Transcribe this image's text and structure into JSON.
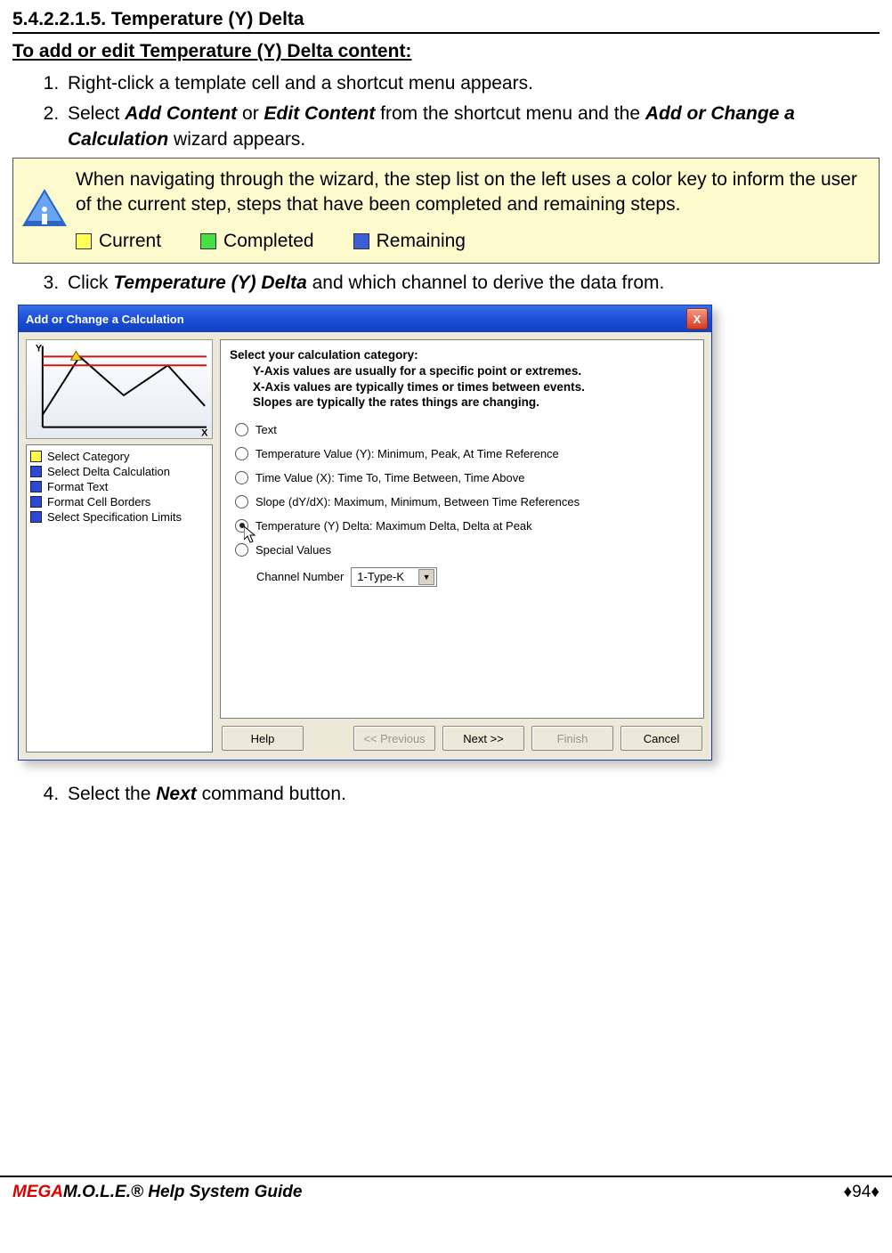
{
  "section": {
    "number": "5.4.2.2.1.5. Temperature (Y) Delta",
    "subhead": "To add or edit Temperature (Y) Delta content:"
  },
  "steps": {
    "s1": "Right-click a template cell and a shortcut menu appears.",
    "s2_pre": "Select ",
    "s2_b1": "Add Content",
    "s2_mid": " or ",
    "s2_b2": "Edit Content",
    "s2_aft": " from the shortcut menu and the ",
    "s2_b3": "Add or Change a Calculation",
    "s2_end": " wizard appears.",
    "s3_pre": "Click ",
    "s3_b1": "Temperature (Y) Delta",
    "s3_end": " and which channel to derive the data from.",
    "s4_pre": "Select the ",
    "s4_b1": "Next",
    "s4_end": " command button."
  },
  "info": {
    "text": "When navigating through the wizard, the step list on the left uses a color key to inform the user of the current step, steps that have been completed and remaining steps.",
    "k1": "Current",
    "k2": "Completed",
    "k3": "Remaining"
  },
  "dialog": {
    "title": "Add or Change a Calculation",
    "close": "X",
    "steps": {
      "a": "Select Category",
      "b": "Select Delta Calculation",
      "c": "Format Text",
      "d": "Format Cell Borders",
      "e": "Select Specification Limits"
    },
    "prompt": {
      "l1": "Select your calculation category:",
      "l2": "Y-Axis values are usually for a specific point or extremes.",
      "l3": "X-Axis values are typically times or times between events.",
      "l4": "Slopes are typically the rates things are changing."
    },
    "radios": {
      "r1": "Text",
      "r2": "Temperature Value (Y):  Minimum, Peak, At Time Reference",
      "r3": "Time Value (X):  Time To, Time Between, Time Above",
      "r4": "Slope (dY/dX):  Maximum, Minimum, Between Time References",
      "r5": "Temperature (Y) Delta:  Maximum Delta, Delta at Peak",
      "r6": "Special  Values"
    },
    "channel": {
      "label": "Channel Number",
      "value": "1-Type-K"
    },
    "buttons": {
      "help": "Help",
      "prev": "<< Previous",
      "next": "Next >>",
      "finish": "Finish",
      "cancel": "Cancel"
    }
  },
  "footer": {
    "brand_m": "MEGA",
    "brand_rest": "M.O.L.E.® Help System Guide",
    "page": "♦94♦"
  }
}
